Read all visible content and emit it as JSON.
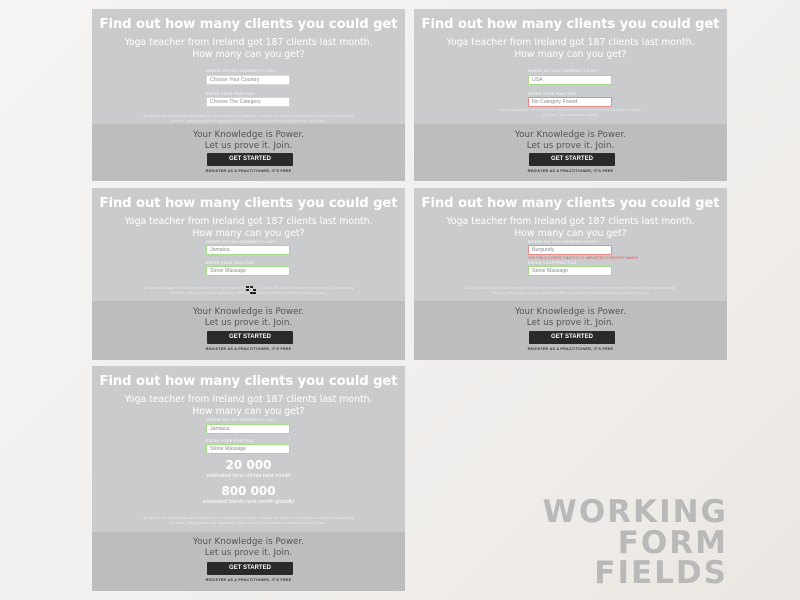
{
  "common": {
    "title": "Find out how many clients you could get",
    "subtitle_line1": "Yoga teacher from Ireland got 187 clients last month.",
    "subtitle_line2": "How many can you get?",
    "country_label": "Where do you currently live?",
    "category_label": "Enter your practice",
    "knowledge_line1": "Your Knowledge is Power.",
    "knowledge_line2": "Let us prove it. Join.",
    "button_label": "GET STARTED",
    "register_text": "REGISTER AS A PRACTITIONER, IT'S FREE"
  },
  "cards": [
    {
      "country_value": "Choose Your Country",
      "category_value": "Choose The Category",
      "fine_print": "All figures are approximate and based on our independent research. It shows the number of clients you can get by advertising services, selling goods and organising offline and online events and sessions via Care Spark."
    },
    {
      "country_value": "USA",
      "category_value": "No Category Found",
      "fine_print": "Your practice was not on the list? Join Care Spark now to see our full range of 1000+ practices. Your clients are waiting."
    },
    {
      "country_value": "Jamaica",
      "category_value": "Stone Massage",
      "fine_print": "All figures are approximate and based on our independent research. It shows the number of clients you can get by advertising services, selling goods and organising offline and online events and sessions via Care Spark."
    },
    {
      "country_value": "Burgundy",
      "category_value": "Stone Massage",
      "error_text": "The field doesn't match to imported country names",
      "fine_print": "All figures are approximate and based on our independent research. It shows the number of clients you can get by advertising services, selling goods and organising offline and online events and sessions via Care Spark."
    },
    {
      "country_value": "Jamaica",
      "category_value": "Stone Massage",
      "stat1_value": "20 000",
      "stat1_label": "estimated local clients next month",
      "stat2_value": "800 000",
      "stat2_label": "estimated clients next month globally",
      "fine_print": "All figures are approximate and based on our independent research. It shows the number of clients you can get by advertising services, selling goods and organising offline and online events and sessions via Care Spark."
    }
  ],
  "watermark": {
    "line1": "WORKING",
    "line2": "FORM",
    "line3": "FIELDS"
  },
  "colors": {
    "card_bg": "#c9cbcd",
    "card_bottom_bg": "#bdbdbd",
    "button_bg": "#2a2a2a",
    "valid_border": "#a6d98a",
    "error_border": "#e88a8a",
    "error_text": "#d9534f",
    "watermark": "#b9b9b9"
  }
}
